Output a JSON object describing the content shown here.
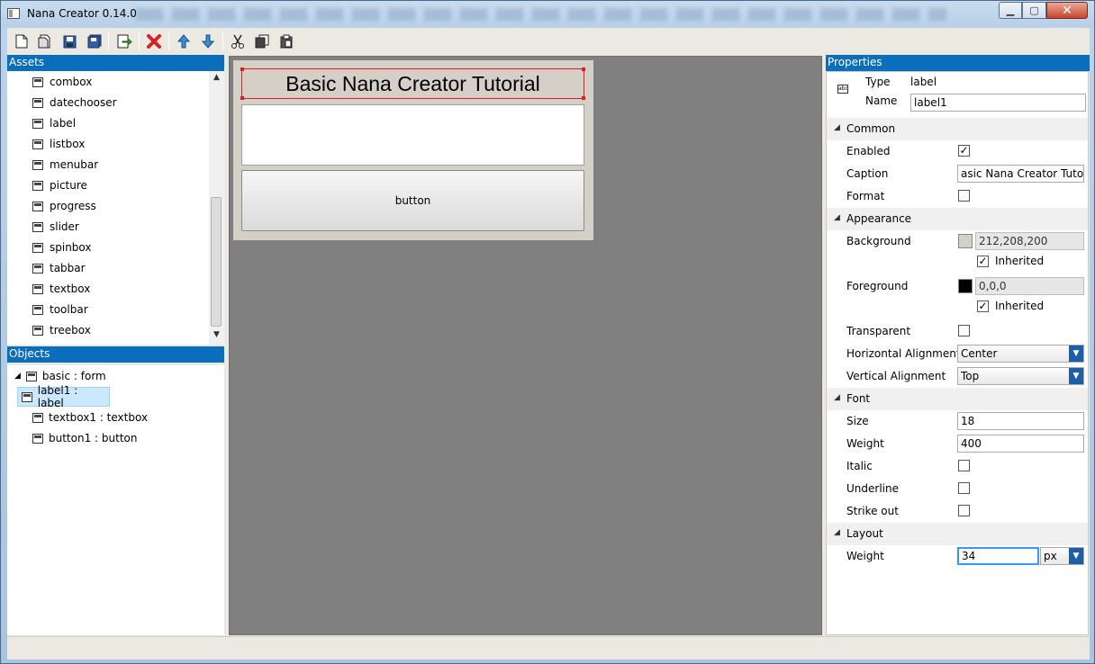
{
  "window": {
    "title": "Nana Creator 0.14.0"
  },
  "toolbar": {
    "buttons": [
      "new-icon",
      "open-icon",
      "save-icon",
      "save-as-icon",
      "generate-icon",
      "delete-icon",
      "move-up-icon",
      "move-down-icon",
      "cut-icon",
      "copy-icon",
      "paste-icon"
    ]
  },
  "assets": {
    "header": "Assets",
    "items": [
      "combox",
      "datechooser",
      "label",
      "listbox",
      "menubar",
      "picture",
      "progress",
      "slider",
      "spinbox",
      "tabbar",
      "textbox",
      "toolbar",
      "treebox"
    ]
  },
  "objects": {
    "header": "Objects",
    "items": [
      "basic : form",
      "label1 : label",
      "textbox1 : textbox",
      "button1 : button"
    ]
  },
  "preview": {
    "label_caption": "Basic Nana Creator Tutorial",
    "button_caption": "button"
  },
  "properties": {
    "header": "Properties",
    "type_label": "Type",
    "type_value": "label",
    "name_label": "Name",
    "name_value": "label1",
    "sections": {
      "common": "Common",
      "appearance": "Appearance",
      "font": "Font",
      "layout": "Layout"
    },
    "enabled_label": "Enabled",
    "caption_label": "Caption",
    "caption_value": "asic Nana Creator Tutorial",
    "format_label": "Format",
    "background_label": "Background",
    "background_value": "212,208,200",
    "background_color": "#d4d0c8",
    "inherited_label": "Inherited",
    "foreground_label": "Foreground",
    "foreground_value": "0,0,0",
    "foreground_color": "#000000",
    "transparent_label": "Transparent",
    "halign_label": "Horizontal Alignment",
    "halign_value": "Center",
    "valign_label": "Vertical Alignment",
    "valign_value": "Top",
    "size_label": "Size",
    "size_value": "18",
    "weight_label": "Weight",
    "weight_value": "400",
    "italic_label": "Italic",
    "underline_label": "Underline",
    "strikeout_label": "Strike out",
    "layout_weight_label": "Weight",
    "layout_weight_value": "34",
    "layout_unit_value": "px"
  },
  "checkbox_mark": "✓"
}
